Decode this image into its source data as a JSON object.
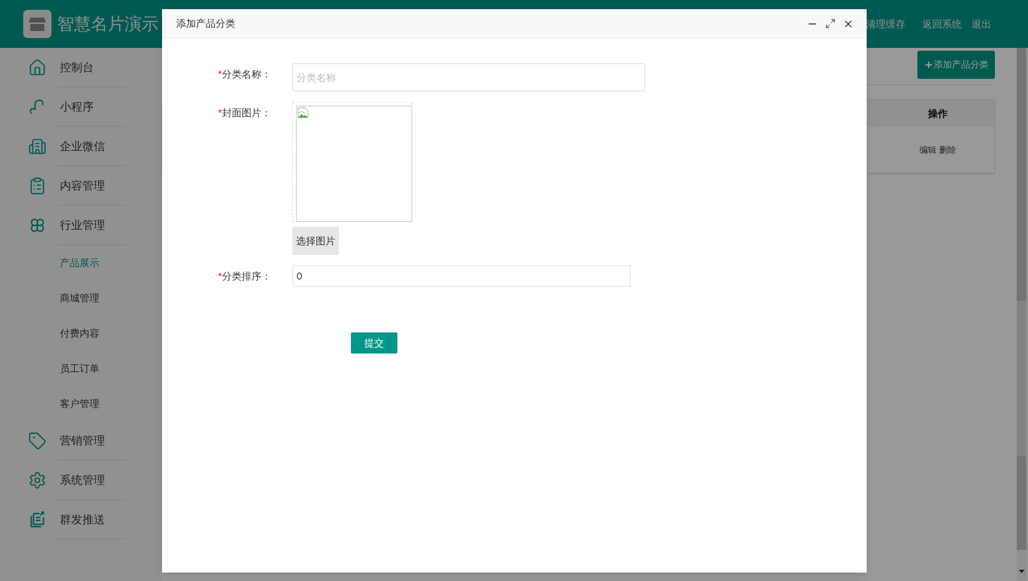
{
  "brand": {
    "title": "智慧名片演示"
  },
  "header_links": [
    "清理缓存",
    "返回系统",
    "退出"
  ],
  "sidebar": {
    "items": [
      {
        "kind": "main",
        "label": "控制台",
        "selected": false
      },
      {
        "kind": "main",
        "label": "小程序",
        "selected": false
      },
      {
        "kind": "main",
        "label": "企业微信",
        "selected": false
      },
      {
        "kind": "main",
        "label": "内容管理",
        "selected": false
      },
      {
        "kind": "main",
        "label": "行业管理",
        "selected": false
      },
      {
        "kind": "sub",
        "label": "产品展示",
        "selected": true
      },
      {
        "kind": "sub",
        "label": "商城管理",
        "selected": false
      },
      {
        "kind": "sub",
        "label": "付费内容",
        "selected": false
      },
      {
        "kind": "sub",
        "label": "员工订单",
        "selected": false
      },
      {
        "kind": "sub",
        "label": "客户管理",
        "selected": false
      },
      {
        "kind": "main",
        "label": "营销管理",
        "selected": false
      },
      {
        "kind": "main",
        "label": "系统管理",
        "selected": false
      },
      {
        "kind": "main",
        "label": "群发推送",
        "selected": false
      }
    ]
  },
  "toolbar": {
    "add_button": "添加产品分类"
  },
  "table": {
    "columns": [
      "操作"
    ],
    "rows": [
      {
        "actions": [
          "编辑",
          "删除"
        ]
      }
    ]
  },
  "dialog": {
    "title": "添加产品分类",
    "fields": [
      {
        "kind": "text",
        "required_mark": "*",
        "label": "分类名称：",
        "placeholder": "分类名称"
      },
      {
        "kind": "image",
        "required_mark": "*",
        "label": "封面图片：",
        "button": "选择图片"
      },
      {
        "kind": "number",
        "required_mark": "*",
        "label": "分类排序：",
        "value": "0"
      }
    ],
    "submit": "提交"
  }
}
